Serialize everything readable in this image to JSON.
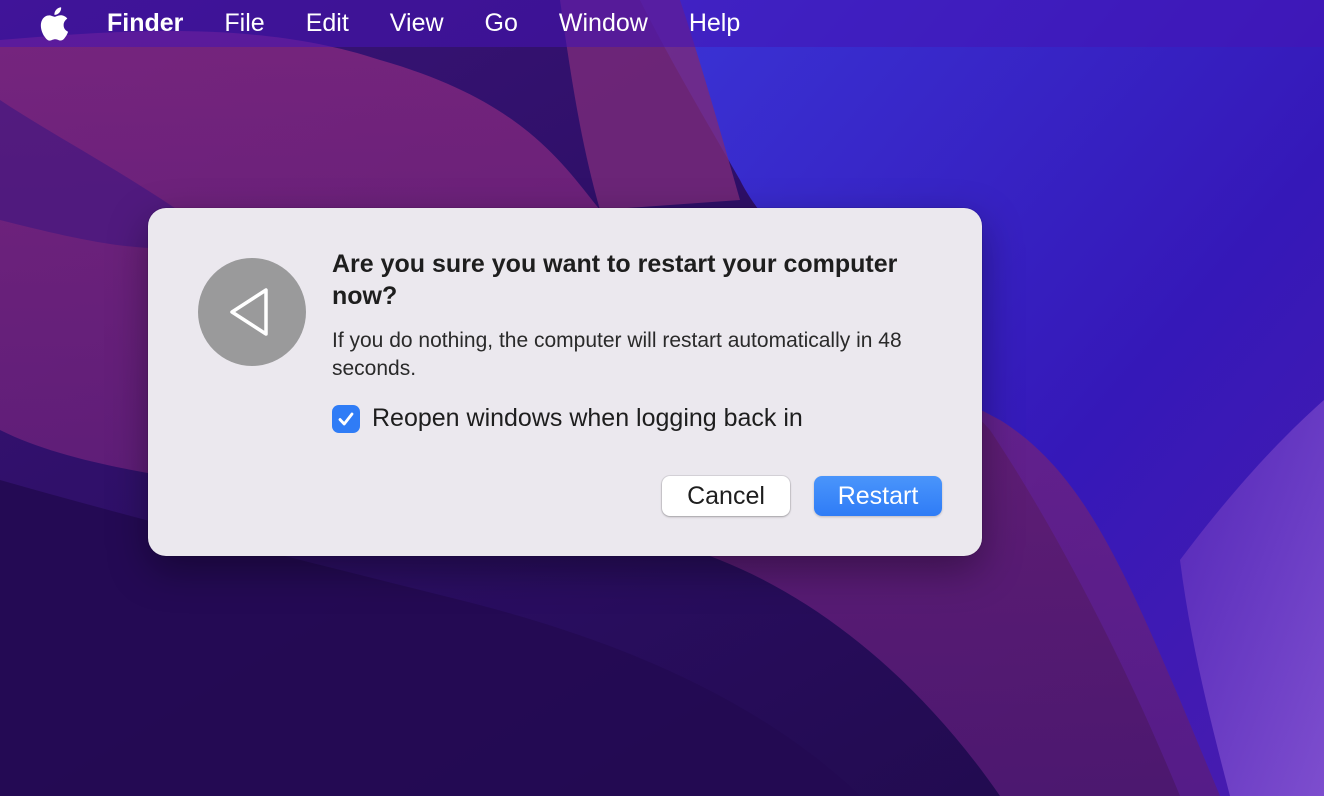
{
  "menubar": {
    "apple_icon": "apple-logo-icon",
    "app_name": "Finder",
    "items": [
      "File",
      "Edit",
      "View",
      "Go",
      "Window",
      "Help"
    ]
  },
  "dialog": {
    "icon": "restart-triangle-icon",
    "title": "Are you sure you want to restart your computer now?",
    "message": "If you do nothing, the computer will restart automatically in 48 seconds.",
    "checkbox": {
      "label": "Reopen windows when logging back in",
      "checked": true
    },
    "buttons": {
      "cancel": "Cancel",
      "restart": "Restart"
    }
  },
  "colors": {
    "accent": "#2f7cf6",
    "dialog_bg": "#ebe8ee",
    "icon_bg": "#9a9a9b"
  }
}
